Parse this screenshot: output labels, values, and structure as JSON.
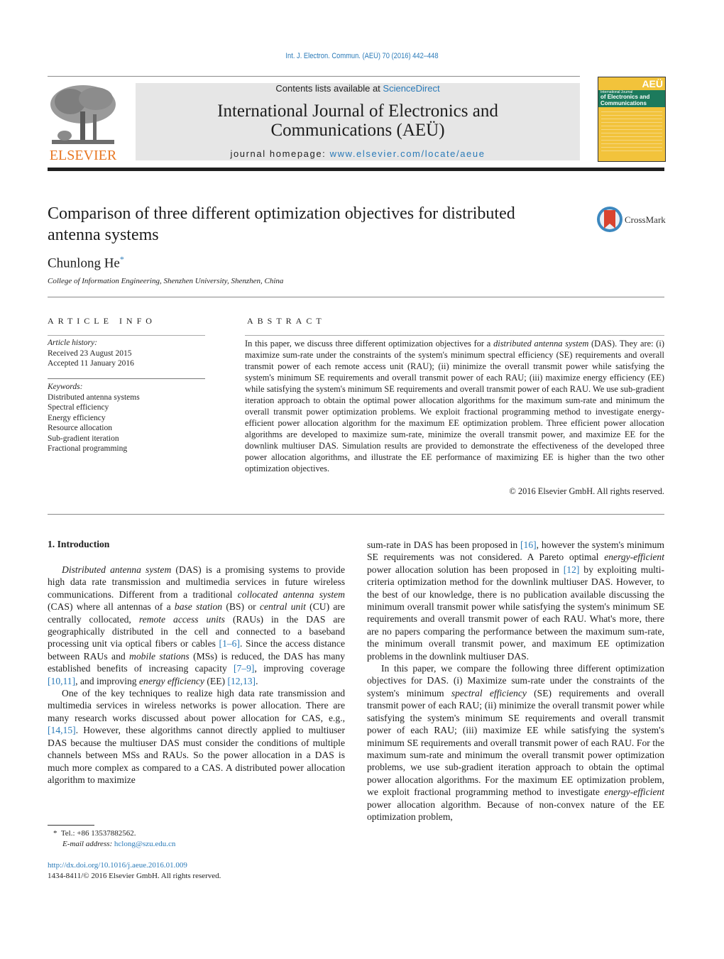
{
  "header": {
    "citation": "Int. J. Electron. Commun. (AEÜ) 70 (2016) 442–448",
    "publisher_logo_text": "ELSEVIER",
    "contents_prefix": "Contents lists available at ",
    "contents_link": "ScienceDirect",
    "journal_title_line1": "International Journal of Electronics and",
    "journal_title_line2": "Communications (AEÜ)",
    "homepage_prefix": "journal homepage: ",
    "homepage_link": "www.elsevier.com/locate/aeue",
    "cover": {
      "badge": "AEÜ",
      "line1": "International Journal",
      "line2": "of Electronics and",
      "line3": "Communications"
    },
    "colors": {
      "link": "#2a7ab8",
      "elsevier_orange": "#e87722",
      "banner_bg": "#e6e6e6"
    }
  },
  "article": {
    "title_line1": "Comparison of three different optimization objectives for distributed",
    "title_line2": "antenna systems",
    "crossmark_label": "CrossMark",
    "author": "Chunlong He",
    "author_mark": "*",
    "affiliation": "College of Information Engineering, Shenzhen University, Shenzhen, China"
  },
  "article_info": {
    "heading": "ARTICLE INFO",
    "history_label": "Article history:",
    "received": "Received 23 August 2015",
    "accepted": "Accepted 11 January 2016",
    "keywords_label": "Keywords:",
    "keywords": [
      "Distributed antenna systems",
      "Spectral efficiency",
      "Energy efficiency",
      "Resource allocation",
      "Sub-gradient iteration",
      "Fractional programming"
    ]
  },
  "abstract": {
    "heading": "ABSTRACT",
    "seg1": "In this paper, we discuss three different optimization objectives for a ",
    "seg1_italic": "distributed antenna system",
    "seg2": " (DAS). They are: (i) maximize sum-rate under the constraints of the system's minimum spectral efficiency (SE) requirements and overall transmit power of each remote access unit (RAU); (ii) minimize the overall transmit power while satisfying the system's minimum SE requirements and overall transmit power of each RAU; (iii) maximize energy efficiency (EE) while satisfying the system's minimum SE requirements and overall transmit power of each RAU. We use sub-gradient iteration approach to obtain the optimal power allocation algorithms for the maximum sum-rate and minimum the overall transmit power optimization problems. We exploit fractional programming method to investigate energy-efficient power allocation algorithm for the maximum EE optimization problem. Three efficient power allocation algorithms are developed to maximize sum-rate, minimize the overall transmit power, and maximize EE for the downlink multiuser DAS. Simulation results are provided to demonstrate the effectiveness of the developed three power allocation algorithms, and illustrate the EE performance of maximizing EE is higher than the two other optimization objectives.",
    "copyright": "© 2016 Elsevier GmbH. All rights reserved."
  },
  "body": {
    "section_heading": "1.  Introduction",
    "p1": {
      "a_i": "Distributed antenna system",
      "b": " (DAS) is a promising systems to provide high data rate transmission and multimedia services in future wireless communications. Different from a traditional ",
      "c_i": "collocated antenna system",
      "d": " (CAS) where all antennas of a ",
      "e_i": "base station",
      "f": " (BS) or ",
      "g_i": "central unit",
      "h": " (CU) are centrally collocated, ",
      "i_i": "remote access units",
      "j": " (RAUs) in the DAS are geographically distributed in the cell and connected to a baseband processing unit via optical fibers or cables ",
      "ref1": "[1–6]",
      "k": ". Since the access distance between RAUs and ",
      "l_i": "mobile stations",
      "m": " (MSs) is reduced, the DAS has many established benefits of increasing capacity ",
      "ref2": "[7–9]",
      "n": ", improving coverage ",
      "ref3": "[10,11]",
      "o": ", and improving ",
      "p_i": "energy efficiency",
      "q": " (EE) ",
      "ref4": "[12,13]",
      "r": "."
    },
    "p2": {
      "a": "One of the key techniques to realize high data rate transmission and multimedia services in wireless networks is power allocation. There are many research works discussed about power allocation for CAS, e.g., ",
      "ref1": "[14,15]",
      "b": ". However, these algorithms cannot directly applied to multiuser DAS because the multiuser DAS must consider the conditions of multiple channels between MSs and RAUs. So the power allocation in a DAS is much more complex as compared to a CAS. A distributed power allocation algorithm to maximize"
    },
    "p3": {
      "a": "sum-rate in DAS has been proposed in ",
      "ref1": "[16]",
      "b": ", however the system's minimum SE requirements was not considered. A Pareto optimal ",
      "c_i": "energy-efficient",
      "d": " power allocation solution has been proposed in ",
      "ref2": "[12]",
      "e": " by exploiting multi-criteria optimization method for the downlink multiuser DAS. However, to the best of our knowledge, there is no publication available discussing the minimum overall transmit power while satisfying the system's minimum SE requirements and overall transmit power of each RAU. What's more, there are no papers comparing the performance between the maximum sum-rate, the minimum overall transmit power, and maximum EE optimization problems in the downlink multiuser DAS."
    },
    "p4": {
      "a": "In this paper, we compare the following three different optimization objectives for DAS. (i) Maximize sum-rate under the constraints of the system's minimum ",
      "b_i": "spectral efficiency",
      "c": " (SE) requirements and overall transmit power of each RAU; (ii) minimize the overall transmit power while satisfying the system's minimum SE requirements and overall transmit power of each RAU; (iii) maximize EE while satisfying the system's minimum SE requirements and overall transmit power of each RAU. For the maximum sum-rate and minimum the overall transmit power optimization problems, we use sub-gradient iteration approach to obtain the optimal power allocation algorithms. For the maximum EE optimization problem, we exploit fractional programming method to investigate ",
      "d_i": "energy-efficient",
      "e": " power allocation algorithm. Because of non-convex nature of the EE optimization problem,"
    }
  },
  "footnote": {
    "mark": "*",
    "tel": "Tel.: +86 13537882562.",
    "email_label": "E-mail address:",
    "email": "hclong@szu.edu.cn"
  },
  "doi": {
    "link": "http://dx.doi.org/10.1016/j.aeue.2016.01.009",
    "issn": "1434-8411/© 2016 Elsevier GmbH. All rights reserved."
  }
}
